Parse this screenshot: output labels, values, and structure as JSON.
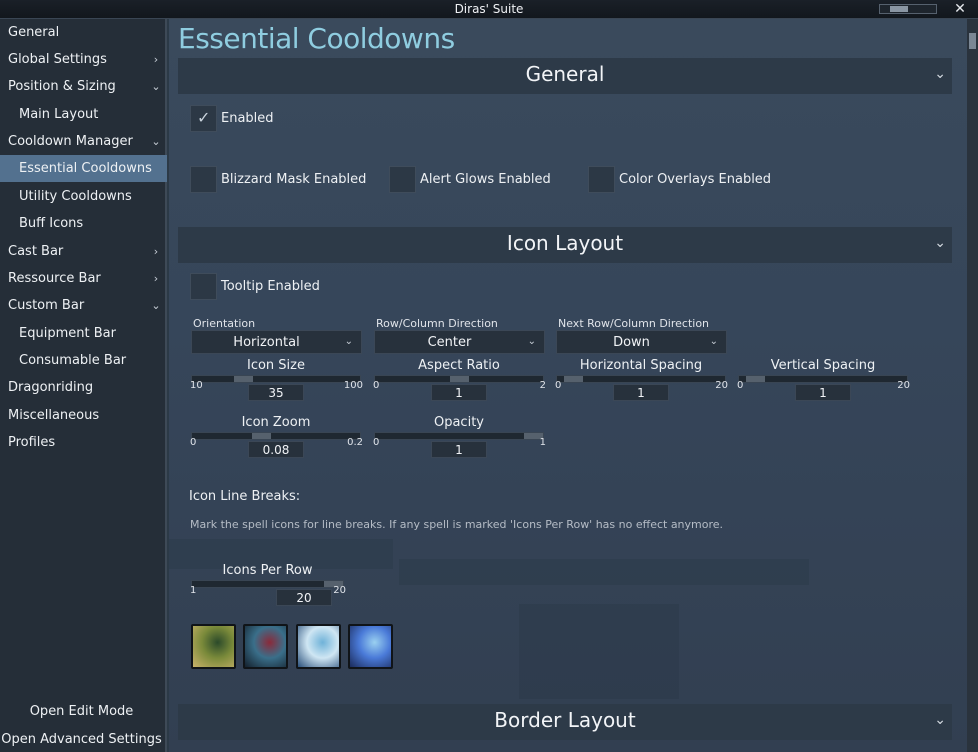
{
  "window": {
    "title": "Diras' Suite",
    "close_glyph": "✕"
  },
  "sidebar": {
    "items": [
      {
        "label": "General",
        "chevron": ""
      },
      {
        "label": "Global Settings",
        "chevron": "›"
      },
      {
        "label": "Position & Sizing",
        "chevron": "⌄"
      },
      {
        "label": "Main Layout",
        "chevron": ""
      },
      {
        "label": "Cooldown Manager",
        "chevron": "⌄"
      },
      {
        "label": "Essential Cooldowns",
        "chevron": ""
      },
      {
        "label": "Utility Cooldowns",
        "chevron": ""
      },
      {
        "label": "Buff Icons",
        "chevron": ""
      },
      {
        "label": "Cast Bar",
        "chevron": "›"
      },
      {
        "label": "Ressource Bar",
        "chevron": "›"
      },
      {
        "label": "Custom Bar",
        "chevron": "⌄"
      },
      {
        "label": "Equipment Bar",
        "chevron": ""
      },
      {
        "label": "Consumable Bar",
        "chevron": ""
      },
      {
        "label": "Dragonriding",
        "chevron": ""
      },
      {
        "label": "Miscellaneous",
        "chevron": ""
      },
      {
        "label": "Profiles",
        "chevron": ""
      }
    ],
    "open_edit_mode": "Open Edit Mode",
    "open_advanced_settings": "Open Advanced Settings"
  },
  "page": {
    "title": "Essential Cooldowns"
  },
  "sections": {
    "general": "General",
    "icon_layout": "Icon Layout",
    "border_layout": "Border Layout",
    "chevron": "⌄"
  },
  "general": {
    "enabled": {
      "label": "Enabled",
      "checked": true,
      "check_glyph": "✓"
    },
    "blizzard_mask": {
      "label": "Blizzard Mask Enabled",
      "checked": false
    },
    "alert_glows": {
      "label": "Alert Glows Enabled",
      "checked": false
    },
    "color_overlays": {
      "label": "Color Overlays Enabled",
      "checked": false
    }
  },
  "icon_layout": {
    "tooltip": {
      "label": "Tooltip Enabled",
      "checked": false
    },
    "orientation": {
      "label": "Orientation",
      "value": "Horizontal"
    },
    "row_column_direction": {
      "label": "Row/Column Direction",
      "value": "Center"
    },
    "next_row_column_direction": {
      "label": "Next Row/Column Direction",
      "value": "Down"
    },
    "dropdown_chevron": "⌄",
    "icon_size": {
      "label": "Icon Size",
      "min": "10",
      "max": "100",
      "value": "35",
      "fraction": 0.28
    },
    "aspect_ratio": {
      "label": "Aspect Ratio",
      "min": "0",
      "max": "2",
      "value": "1",
      "fraction": 0.5
    },
    "horizontal_spacing": {
      "label": "Horizontal Spacing",
      "min": "0",
      "max": "20",
      "value": "1",
      "fraction": 0.05
    },
    "vertical_spacing": {
      "label": "Vertical Spacing",
      "min": "0",
      "max": "20",
      "value": "1",
      "fraction": 0.05
    },
    "icon_zoom": {
      "label": "Icon Zoom",
      "min": "0",
      "max": "0.2",
      "value": "0.08",
      "fraction": 0.4
    },
    "opacity": {
      "label": "Opacity",
      "min": "0",
      "max": "1",
      "value": "1",
      "fraction": 1.0
    }
  },
  "line_breaks": {
    "title": "Icon Line Breaks:",
    "description": "Mark the spell icons for line breaks. If any spell is marked 'Icons Per Row' has no effect anymore.",
    "icons_per_row": {
      "label": "Icons Per Row",
      "min": "1",
      "max": "20",
      "value": "20",
      "fraction": 1.0
    },
    "spell_icons": [
      {
        "name": "spell-icon-1",
        "colors": [
          "#7a8a3a",
          "#2b4a2a",
          "#c9b26a"
        ]
      },
      {
        "name": "spell-icon-2",
        "colors": [
          "#3a6f8a",
          "#8a2a3a",
          "#14202c"
        ]
      },
      {
        "name": "spell-icon-3",
        "colors": [
          "#cfe6f3",
          "#6fb2d8",
          "#2a4f7a"
        ]
      },
      {
        "name": "spell-icon-4",
        "colors": [
          "#4a7ad8",
          "#9ad0f0",
          "#1a2a5a"
        ]
      }
    ]
  }
}
